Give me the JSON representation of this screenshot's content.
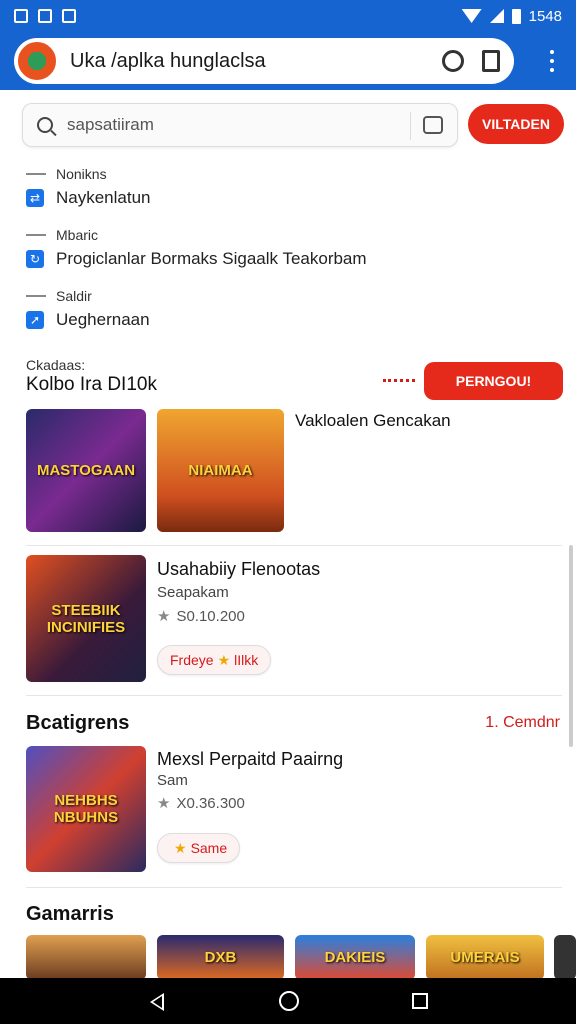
{
  "status": {
    "time": "1548"
  },
  "address_bar": {
    "url_text": "Uka /aplka hunglaclsa"
  },
  "search": {
    "placeholder": "sapsatiiram",
    "go_button": "VILTADEN"
  },
  "filters": [
    {
      "header": "Nonikns",
      "label": "Naykenlatun"
    },
    {
      "header": "Mbaric",
      "label": "Progiclanlar Bormaks Sigaalk Teakorbam"
    },
    {
      "header": "Saldir",
      "label": "Ueghernaan"
    }
  ],
  "section": {
    "small_label": "Ckadaas:",
    "title": "Kolbo Ira DI10k",
    "button": "PERNGOU!"
  },
  "featured": {
    "thumbs": [
      {
        "name": "MASTOGAAN",
        "icon": "game-thumb-heroes"
      },
      {
        "name": "NIAIMAA",
        "icon": "game-thumb-dragon"
      }
    ],
    "description": "Vakloalen Gencakan"
  },
  "game_a": {
    "thumb_text": "STEEBIIK INCINIFIES",
    "title": "Usahabiiy Flenootas",
    "subtitle": "Seapakam",
    "rating": "S0.10.200",
    "chip": "Frdeye",
    "chip_suffix": "lIlkk"
  },
  "categories": {
    "title": "Bcatigrens",
    "link": "1. Cemdnr"
  },
  "game_b": {
    "thumb_text": "NEHBHS NBUHNS",
    "title": "Mexsl Perpaitd Paairng",
    "subtitle": "Sam",
    "rating": "X0.36.300",
    "chip": "Same"
  },
  "bottom_section": {
    "title": "Gamarris",
    "thumbs": [
      "",
      "DXB",
      "DAKIEIS",
      "UMERAIS",
      ""
    ]
  },
  "colors": {
    "brand_blue": "#1664d0",
    "accent_red": "#e5291b"
  }
}
